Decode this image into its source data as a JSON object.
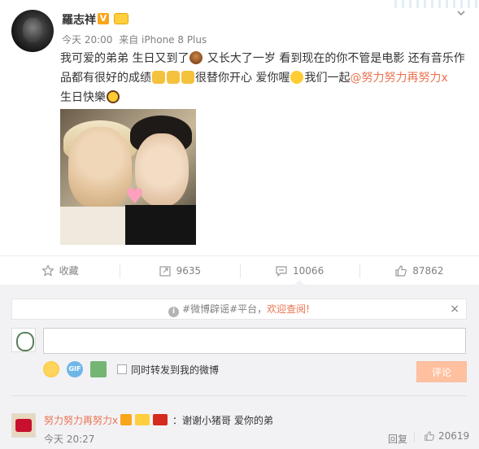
{
  "post": {
    "username": "羅志祥",
    "verified_badge": "V",
    "meta_time": "今天 20:00",
    "meta_source": "来自 iPhone 8 Plus",
    "text_part1": "我可爱的弟弟 生日又到了",
    "text_part2": " 又长大了一岁 看到现在的你不管是电影 还有音乐作品都有很好的成绩",
    "text_part3": "很替你开心 爱你喔",
    "text_part4": "我们一起",
    "mention": "@努力努力再努力x",
    "text_part5": "生日快樂"
  },
  "actions": {
    "favorite": "收藏",
    "repost_count": "9635",
    "comment_count": "10066",
    "like_count": "87862"
  },
  "comments": {
    "notice_prefix": "#微博辟谣#平台，",
    "notice_link": "欢迎查阅!",
    "notice_close": "×",
    "repost_label": "同时转发到我的微博",
    "submit_label": "评论",
    "gif_label": "GIF"
  },
  "reply": {
    "name": "努力努力再努力x",
    "text": "：谢谢小猪哥 爱你的弟",
    "time": "今天 20:27",
    "reply_label": "回复",
    "like_count": "20619"
  },
  "colors": {
    "accent": "#eb7350",
    "muted": "#808080",
    "comment_bg": "#f2f2f5"
  },
  "icons": [
    "chevron-down-icon",
    "favorite-star-icon",
    "repost-icon",
    "comment-icon",
    "like-icon",
    "info-icon",
    "close-icon",
    "emoji-icon",
    "gif-icon",
    "image-icon"
  ]
}
